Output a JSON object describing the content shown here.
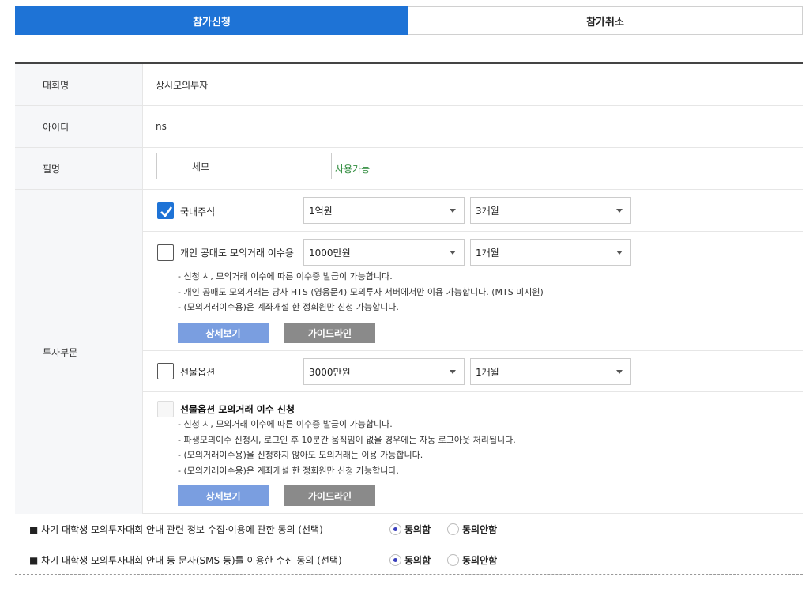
{
  "tabs": {
    "apply": "참가신청",
    "cancel": "참가취소"
  },
  "fields": {
    "contest_label": "대회명",
    "contest_value": "상시모의투자",
    "id_label": "아이디",
    "id_value": "ns",
    "nick_label": "필명",
    "nick_value": "체모",
    "nick_status": "사용가능",
    "invest_label": "투자부문"
  },
  "sections": {
    "domestic": {
      "label": "국내주식",
      "checked": true,
      "amount": "1억원",
      "period": "3개월"
    },
    "short": {
      "label": "개인 공매도 모의거래 이수용",
      "checked": false,
      "amount": "1000만원",
      "period": "1개월",
      "notes": [
        "- 신청 시, 모의거래 이수에 따른 이수증 발급이 가능합니다.",
        "- 개인 공매도 모의거래는 당사 HTS (영웅문4) 모의투자 서버에서만 이용 가능합니다. (MTS 미지원)",
        "- (모의거래이수용)은 계좌개설 한 정회원만 신청 가능합니다."
      ],
      "detail_btn": "상세보기",
      "guide_btn": "가이드라인"
    },
    "futures": {
      "label": "선물옵션",
      "checked": false,
      "amount": "3000만원",
      "period": "1개월"
    },
    "futures_course": {
      "title": "선물옵션 모의거래 이수 신청",
      "notes": [
        "- 신청 시, 모의거래 이수에 따른 이수증 발급이 가능합니다.",
        "- 파생모의이수 신청시, 로그인 후 10분간 움직임이 없을 경우에는 자동 로그아웃 처리됩니다.",
        "- (모의거래이수용)을 신청하지 않아도 모의거래는 이용 가능합니다.",
        "- (모의거래이수용)은 계좌개설 한 정회원만 신청 가능합니다."
      ],
      "detail_btn": "상세보기",
      "guide_btn": "가이드라인"
    }
  },
  "consents": [
    {
      "text": "■ 차기 대학생 모의투자대회 안내 관련 정보 수집·이용에 관한 동의 (선택)",
      "agree": "동의함",
      "disagree": "동의안함",
      "selected": "agree"
    },
    {
      "text": "■ 차기 대학생 모의투자대회 안내 등 문자(SMS 등)를 이용한 수신 동의 (선택)",
      "agree": "동의함",
      "disagree": "동의안함",
      "selected": "agree"
    }
  ],
  "colors": {
    "primary": "#1e73d6",
    "success": "#2e8b3c",
    "btn_blue": "#7a9ee0",
    "btn_gray": "#8a8a8a"
  }
}
